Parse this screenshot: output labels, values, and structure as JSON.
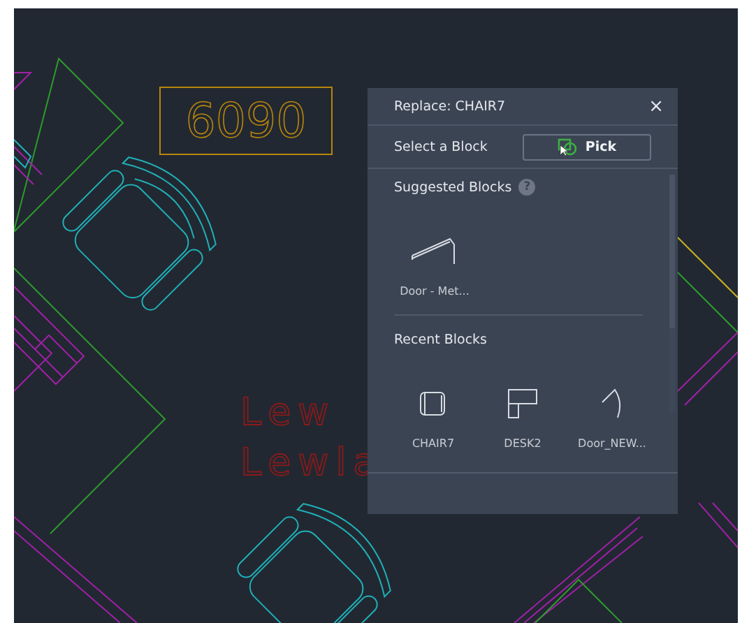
{
  "drawing": {
    "room_number": "6090",
    "name_lines": [
      "Lew",
      "Lewla"
    ]
  },
  "panel": {
    "title": "Replace: CHAIR7",
    "close": "×",
    "select_label": "Select a Block",
    "pick_button": "Pick",
    "suggested": {
      "heading": "Suggested Blocks",
      "help": "?",
      "items": [
        {
          "label": "Door - Met...",
          "kind": "door-metal"
        }
      ]
    },
    "recent": {
      "heading": "Recent Blocks",
      "items": [
        {
          "label": "CHAIR7",
          "kind": "chair"
        },
        {
          "label": "DESK2",
          "kind": "desk"
        },
        {
          "label": "Door_NEW...",
          "kind": "door"
        }
      ]
    }
  }
}
